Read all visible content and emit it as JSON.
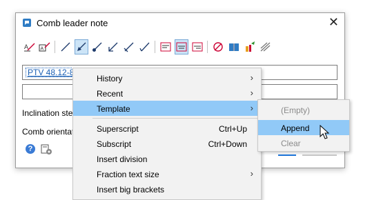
{
  "dialog": {
    "title": "Comb leader note",
    "close_glyph": "✕",
    "field1_value": "PTV 48.12-8",
    "label_inclination": "Inclination step",
    "label_orientation": "Comb orientatio",
    "help_glyph": "?"
  },
  "toolbar_icons": [
    "leader-text-icon",
    "leader-text-box-icon",
    "line-icon",
    "arrow-filled-icon",
    "dot-leader-icon",
    "arrow-open-icon",
    "arrow-slash-icon",
    "tick-leader-icon",
    "align-left-icon",
    "align-center-icon",
    "align-right-icon",
    "no-leader-icon",
    "book-icon",
    "paint-icon",
    "fork-icon"
  ],
  "context_menu": {
    "items": [
      {
        "label": "History",
        "shortcut": "",
        "submenu": true
      },
      {
        "label": "Recent",
        "shortcut": "",
        "submenu": true
      },
      {
        "label": "Template",
        "shortcut": "",
        "submenu": true,
        "highlighted": true
      },
      {
        "label": "Superscript",
        "shortcut": "Ctrl+Up",
        "submenu": false
      },
      {
        "label": "Subscript",
        "shortcut": "Ctrl+Down",
        "submenu": false
      },
      {
        "label": "Insert division",
        "shortcut": "",
        "submenu": false
      },
      {
        "label": "Fraction text size",
        "shortcut": "",
        "submenu": true
      },
      {
        "label": "Insert big brackets",
        "shortcut": "",
        "submenu": false
      }
    ]
  },
  "template_submenu": {
    "items": [
      {
        "label": "(Empty)",
        "enabled": false
      },
      {
        "label": "Append",
        "enabled": true,
        "highlighted": true
      },
      {
        "label": "Clear",
        "enabled": false
      }
    ]
  },
  "colors": {
    "highlight": "#91c9f7",
    "link_blue": "#1a5fb4",
    "active_tool_bg": "#cce4f7"
  }
}
